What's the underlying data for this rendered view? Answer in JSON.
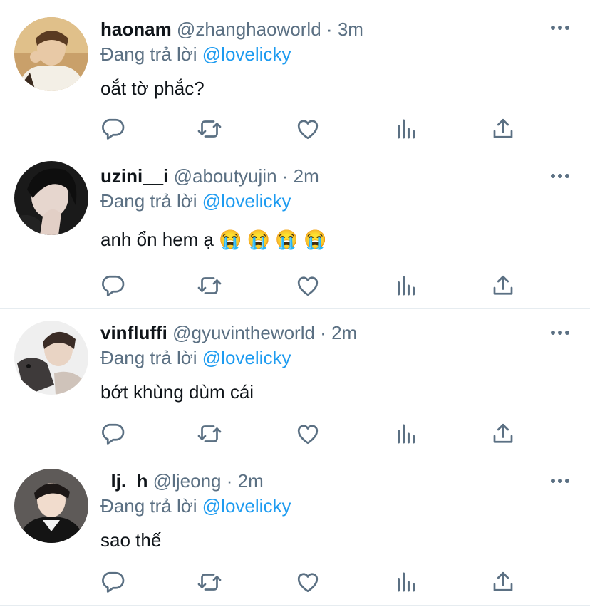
{
  "reply_prefix": "Đang trả lời",
  "colors": {
    "text": "#0f1419",
    "secondary": "#5b7083",
    "mention": "#1d9bf0",
    "divider": "#e6ecf0"
  },
  "icons": [
    "reply-icon",
    "retweet-icon",
    "like-icon",
    "analytics-icon",
    "share-icon",
    "more-icon"
  ],
  "tweets": [
    {
      "name": "haonam",
      "handle": "@zhanghaoworld",
      "separator": "·",
      "time": "3m",
      "reply_to": "@lovelicky",
      "text": "oắt tờ phắc?"
    },
    {
      "name": "uzini__i",
      "handle": "@aboutyujin",
      "separator": "·",
      "time": "2m",
      "reply_to": "@lovelicky",
      "text": "anh ổn hem ạ 😭 😭 😭 😭"
    },
    {
      "name": "vinfluffi",
      "handle": "@gyuvintheworld",
      "separator": "·",
      "time": "2m",
      "reply_to": "@lovelicky",
      "text": "bớt khùng dùm cái"
    },
    {
      "name": "_lj._h",
      "handle": "@ljeong",
      "separator": "·",
      "time": "2m",
      "reply_to": "@lovelicky",
      "text": "sao thế"
    }
  ]
}
